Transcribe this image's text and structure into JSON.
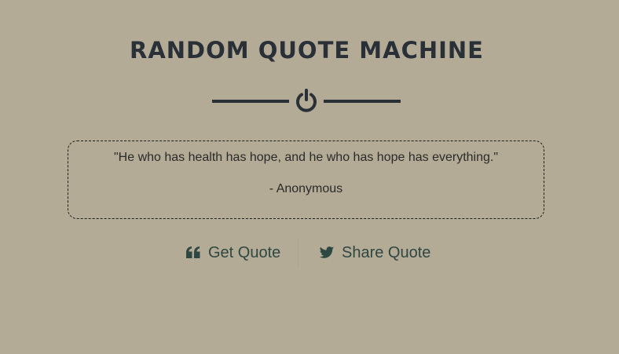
{
  "header": {
    "title": "RANDOM QUOTE MACHINE"
  },
  "quote": {
    "text": "\"He who has health has hope, and he who has hope has everything.\"",
    "author": "- Anonymous"
  },
  "actions": {
    "get_quote_label": "Get Quote",
    "share_quote_label": "Share Quote",
    "get_quote_icon": "quote-left-icon",
    "share_quote_icon": "twitter-icon"
  },
  "colors": {
    "background": "#b3ab96",
    "title": "#2a3038",
    "button_text": "#2f4742"
  }
}
